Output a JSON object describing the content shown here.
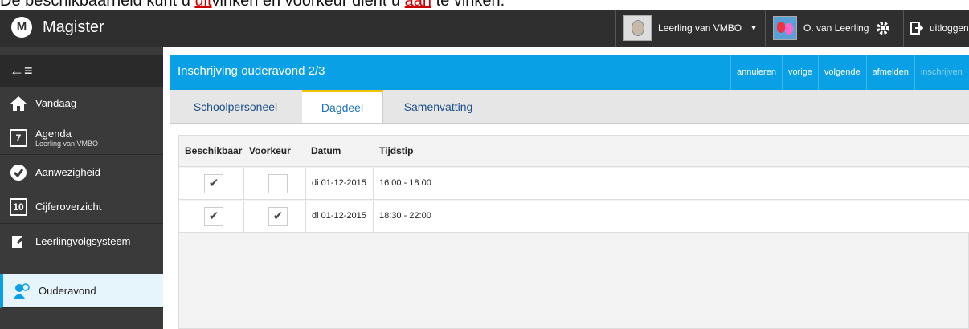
{
  "caption": {
    "part1": "De beschikbaarheid kunt u ",
    "uit": "uit",
    "part2": "vinken en voorkeur dient u ",
    "aan": "aan",
    "part3": " te vinken."
  },
  "app": {
    "logo": "M",
    "title": "Magister"
  },
  "topbar": {
    "student_label": "Leerling van VMBO",
    "parent_label": "O. van Leerling",
    "logout_label": "uitloggen"
  },
  "sidebar": {
    "collapse_icon": "←≡",
    "items": [
      {
        "label": "Vandaag",
        "icon": "home-icon"
      },
      {
        "label": "Agenda",
        "sub": "Leerling van VMBO",
        "icon_text": "7"
      },
      {
        "label": "Aanwezigheid",
        "icon": "check-circle-icon"
      },
      {
        "label": "Cijferoverzicht",
        "icon_text": "10"
      },
      {
        "label": "Leerlingvolgsysteem",
        "icon": "edit-icon"
      },
      {
        "label": "Ouderavond",
        "icon": "people-icon"
      }
    ]
  },
  "header": {
    "title": "Inschrijving ouderavond 2/3",
    "actions": [
      "annuleren",
      "vorige",
      "volgende",
      "afmelden",
      "inschrijven"
    ]
  },
  "tabs": [
    "Schoolpersoneel",
    "Dagdeel",
    "Samenvatting"
  ],
  "table": {
    "columns": [
      "Beschikbaar",
      "Voorkeur",
      "Datum",
      "Tijdstip"
    ],
    "rows": [
      {
        "beschikbaar": true,
        "voorkeur": false,
        "datum": "di 01-12-2015",
        "tijdstip": "16:00 - 18:00"
      },
      {
        "beschikbaar": true,
        "voorkeur": true,
        "datum": "di 01-12-2015",
        "tijdstip": "18:30 - 22:00"
      }
    ]
  },
  "colors": {
    "accent": "#0aa0e6",
    "topbar": "#2f2f2f",
    "sidebar": "#3a3a3a",
    "active_tab_border": "#f2c200"
  }
}
